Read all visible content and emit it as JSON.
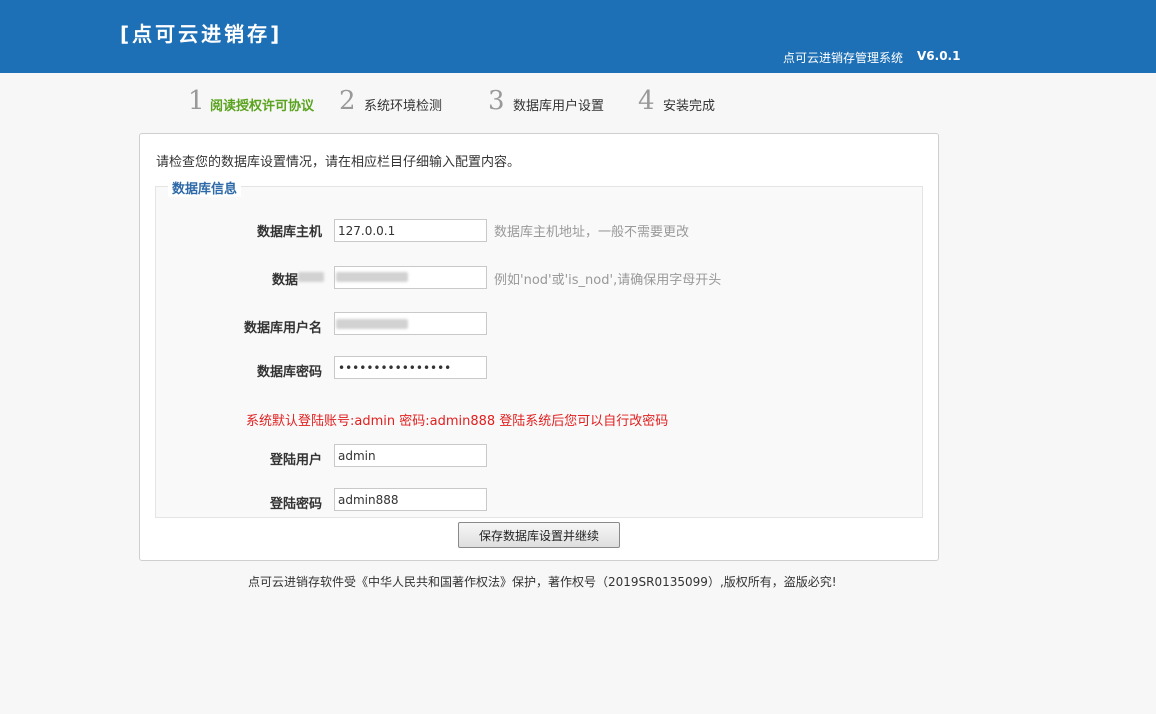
{
  "header": {
    "logo": "[点可云进销存]",
    "system_name": "点可云进销存管理系统",
    "version": "V6.0.1"
  },
  "steps": [
    {
      "num": "1",
      "label": "阅读授权许可协议",
      "active": true
    },
    {
      "num": "2",
      "label": "系统环境检测",
      "active": false
    },
    {
      "num": "3",
      "label": "数据库用户设置",
      "active": false
    },
    {
      "num": "4",
      "label": "安装完成",
      "active": false
    }
  ],
  "panel": {
    "intro": "请检查您的数据库设置情况，请在相应栏目仔细输入配置内容。",
    "legend": "数据库信息",
    "fields": {
      "db_host": {
        "label": "数据库主机",
        "value": "127.0.0.1",
        "hint": "数据库主机地址，一般不需要更改"
      },
      "db_name": {
        "label": "数据",
        "value": "",
        "hint": "例如'nod'或'is_nod',请确保用字母开头"
      },
      "db_user": {
        "label": "数据库用户名",
        "value": ""
      },
      "db_pass": {
        "label": "数据库密码",
        "value": "••••••••••••••••"
      },
      "login_user": {
        "label": "登陆用户",
        "value": "admin"
      },
      "login_pass": {
        "label": "登陆密码",
        "value": "admin888"
      }
    },
    "notice": "系统默认登陆账号:admin 密码:admin888 登陆系统后您可以自行改密码",
    "save_button": "保存数据库设置并继续"
  },
  "footer": "点可云进销存软件受《中华人民共和国著作权法》保护，著作权号（2019SR0135099）,版权所有，盗版必究!",
  "colors": {
    "header_bg": "#1e70b6",
    "active_step": "#5aa31e",
    "legend": "#2e6aa8",
    "notice": "#e12020"
  }
}
